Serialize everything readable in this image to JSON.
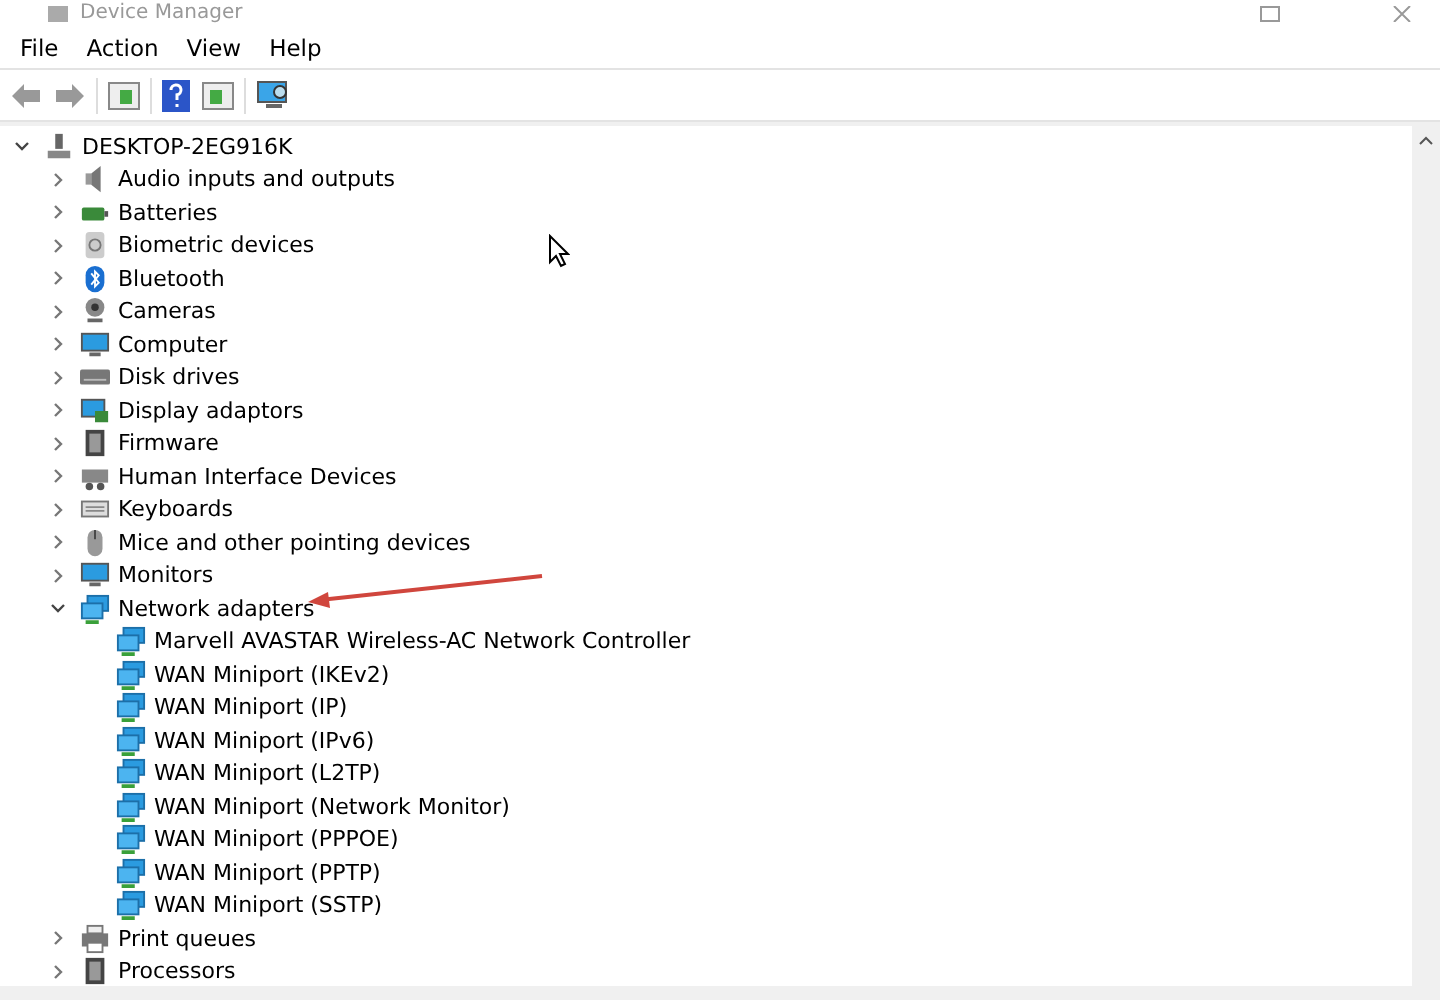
{
  "window": {
    "title": "Device Manager"
  },
  "menu": [
    "File",
    "Action",
    "View",
    "Help"
  ],
  "tree": {
    "label": "DESKTOP-2EG916K",
    "kind": "computer-root",
    "expanded": true,
    "children": [
      {
        "label": "Audio inputs and outputs",
        "kind": "audio",
        "expanded": false
      },
      {
        "label": "Batteries",
        "kind": "battery",
        "expanded": false
      },
      {
        "label": "Biometric devices",
        "kind": "biometric",
        "expanded": false
      },
      {
        "label": "Bluetooth",
        "kind": "bluetooth",
        "expanded": false
      },
      {
        "label": "Cameras",
        "kind": "camera",
        "expanded": false
      },
      {
        "label": "Computer",
        "kind": "monitor",
        "expanded": false
      },
      {
        "label": "Disk drives",
        "kind": "disk",
        "expanded": false
      },
      {
        "label": "Display adaptors",
        "kind": "display",
        "expanded": false
      },
      {
        "label": "Firmware",
        "kind": "chip",
        "expanded": false
      },
      {
        "label": "Human Interface Devices",
        "kind": "hid",
        "expanded": false
      },
      {
        "label": "Keyboards",
        "kind": "keyboard",
        "expanded": false
      },
      {
        "label": "Mice and other pointing devices",
        "kind": "mouse",
        "expanded": false
      },
      {
        "label": "Monitors",
        "kind": "monitor",
        "expanded": false
      },
      {
        "label": "Network adapters",
        "kind": "network",
        "expanded": true,
        "children": [
          {
            "label": "Marvell AVASTAR Wireless-AC Network Controller",
            "kind": "network"
          },
          {
            "label": "WAN Miniport (IKEv2)",
            "kind": "network"
          },
          {
            "label": "WAN Miniport (IP)",
            "kind": "network"
          },
          {
            "label": "WAN Miniport (IPv6)",
            "kind": "network"
          },
          {
            "label": "WAN Miniport (L2TP)",
            "kind": "network"
          },
          {
            "label": "WAN Miniport (Network Monitor)",
            "kind": "network"
          },
          {
            "label": "WAN Miniport (PPPOE)",
            "kind": "network"
          },
          {
            "label": "WAN Miniport (PPTP)",
            "kind": "network"
          },
          {
            "label": "WAN Miniport (SSTP)",
            "kind": "network"
          }
        ]
      },
      {
        "label": "Print queues",
        "kind": "printer",
        "expanded": false
      },
      {
        "label": "Processors",
        "kind": "chip",
        "expanded": false
      }
    ]
  }
}
